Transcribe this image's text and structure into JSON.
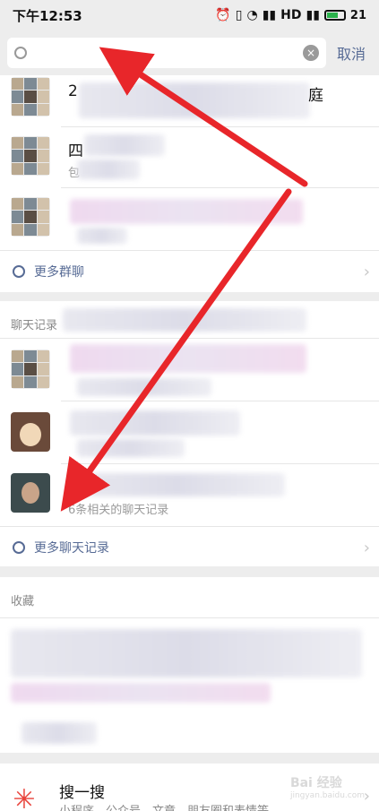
{
  "status_bar": {
    "time": "下午12:53",
    "battery": "21"
  },
  "search": {
    "value": "",
    "placeholder": "",
    "cancel_label": "取消"
  },
  "groups": {
    "items": [
      {
        "title_visible": "2",
        "title_tail": "庭",
        "subtitle": ""
      },
      {
        "title_visible": "四",
        "title_tail": "",
        "subtitle": "包"
      },
      {
        "title_visible": "",
        "title_tail": "",
        "subtitle": ""
      }
    ],
    "more_label": "更多群聊"
  },
  "chat_records": {
    "header": "聊天记录",
    "items": [
      {
        "title": "",
        "subtitle": ""
      },
      {
        "title": "",
        "subtitle": ""
      },
      {
        "title": "",
        "subtitle": "6条相关的聊天记录"
      }
    ],
    "more_label": "更多聊天记录"
  },
  "favorites": {
    "header": "收藏"
  },
  "sousou": {
    "title": "搜一搜",
    "subtitle": "小程序、公众号、文章、朋友圈和表情等"
  },
  "watermark": {
    "brand": "Bai 经验",
    "url": "jingyan.baidu.com"
  },
  "colors": {
    "link": "#576b95",
    "arrow": "#e8262a",
    "background": "#ededed"
  }
}
